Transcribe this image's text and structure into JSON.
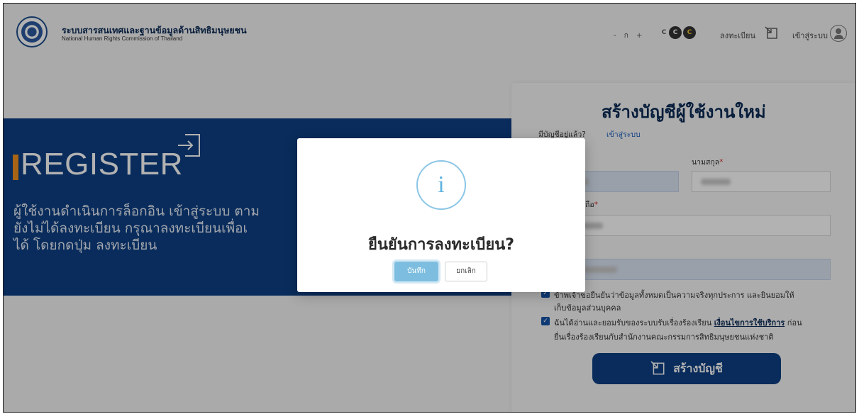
{
  "header": {
    "org_name_th": "ระบบสารสนเทศและฐานข้อมูลด้านสิทธิมนุษยชน",
    "org_name_en": "National Human Rights Commission of Thailand",
    "font_size_control": "- ก +",
    "contrast_options": [
      "C",
      "C",
      "C"
    ],
    "register_label": "ลงทะเบียน",
    "login_label": "เข้าสู่ระบบ"
  },
  "hero": {
    "title": "REGISTER",
    "lines": [
      "ผู้ใช้งานดำเนินการล็อกอิน เข้าสู่ระบบ ตาม",
      "ยังไม่ได้ลงทะเบียน กรุณาลงทะเบียนเพื่อเ",
      "ได้ โดยกดปุ่ม ลงทะเบียน"
    ]
  },
  "form": {
    "title": "สร้างบัญชีผู้ใช้งานใหม่",
    "have_account": "มีบัญชีอยู่แล้ว?",
    "login_link": "เข้าสู่ระบบ",
    "lastname_label": "นามสกุล",
    "phone_label": "ถือ",
    "required_mark": "*",
    "consent_1_line1": "ข้าพเจ้าขอยืนยันว่าข้อมูลทั้งหมดเป็นความจริงทุกประการ และยินยอมให้",
    "consent_1_line2": "เก็บข้อมูลส่วนบุคคล",
    "consent_2_prefix": "ฉันได้อ่านและยอมรับของระบบรับเรื่องร้องเรียน",
    "consent_2_link": "เงื่อนไขการใช้บริการ",
    "consent_2_suffix": "ก่อน",
    "consent_2_line2": "ยื่นเรื่องร้องเรียนกับสำนักงานคณะกรรมการสิทธิมนุษยชนแห่งชาติ",
    "create_button": "สร้างบัญชี"
  },
  "modal": {
    "icon": "info-icon",
    "icon_glyph": "i",
    "title": "ยืนยันการลงทะเบียน?",
    "confirm_button": "บันทึก",
    "cancel_button": "ยกเลิก"
  },
  "colors": {
    "primary": "#0e3f84",
    "accent": "#f0901e",
    "info": "#5fb3e0"
  }
}
